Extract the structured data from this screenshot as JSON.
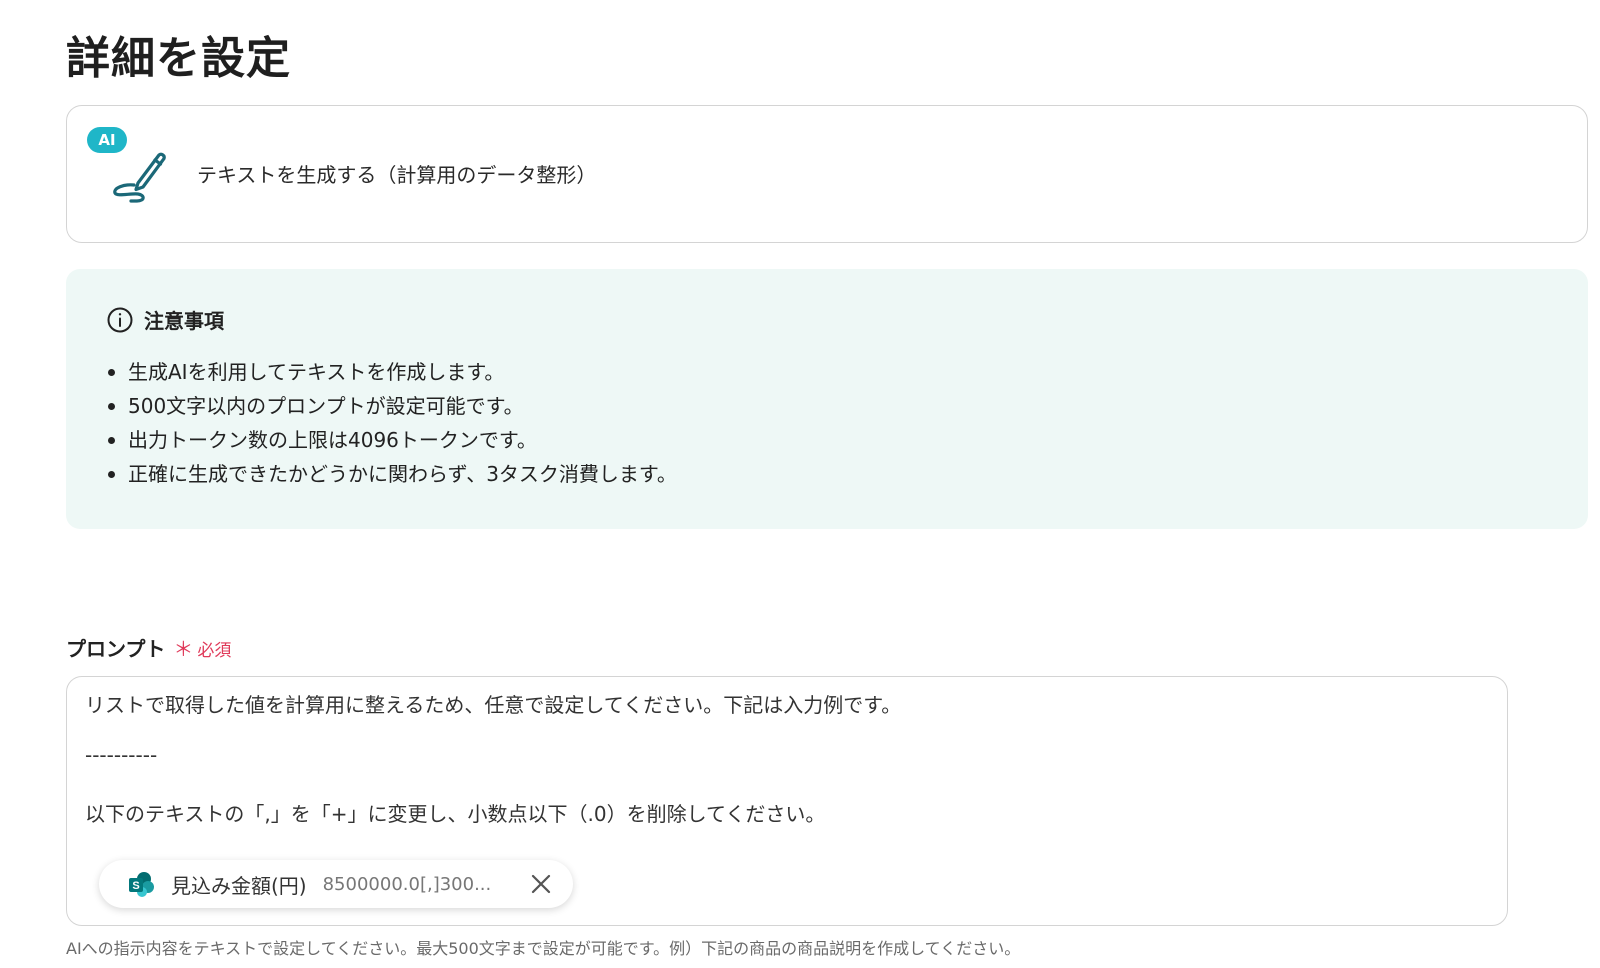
{
  "page": {
    "title": "詳細を設定"
  },
  "action": {
    "badge": "AI",
    "title": "テキストを生成する（計算用のデータ整形）",
    "icon": "pen-icon"
  },
  "notice": {
    "title": "注意事項",
    "icon": "info-icon",
    "items": [
      "生成AIを利用してテキストを作成します。",
      "500文字以内のプロンプトが設定可能です。",
      "出力トークン数の上限は4096トークンです。",
      "正確に生成できたかどうかに関わらず、3タスク消費します。"
    ]
  },
  "prompt": {
    "label": "プロンプト",
    "required_star": "＊",
    "required_text": "必須",
    "lines": [
      "リストで取得した値を計算用に整えるため、任意で設定してください。下記は入力例です。",
      "----------",
      "以下のテキストの「,」を「+」に変更し、小数点以下（.0）を削除してください。"
    ],
    "chip": {
      "icon": "sharepoint-icon",
      "label": "見込み金額(円)",
      "value": "8500000.0[,]300..."
    },
    "help": "AIへの指示内容をテキストで設定してください。最大500文字まで設定が可能です。例）下記の商品の商品説明を作成してください。"
  },
  "colors": {
    "accent": "#1fb6c8",
    "notice_bg": "#eef8f6",
    "required": "#e03a5a",
    "icon_dark": "#1b6878"
  }
}
